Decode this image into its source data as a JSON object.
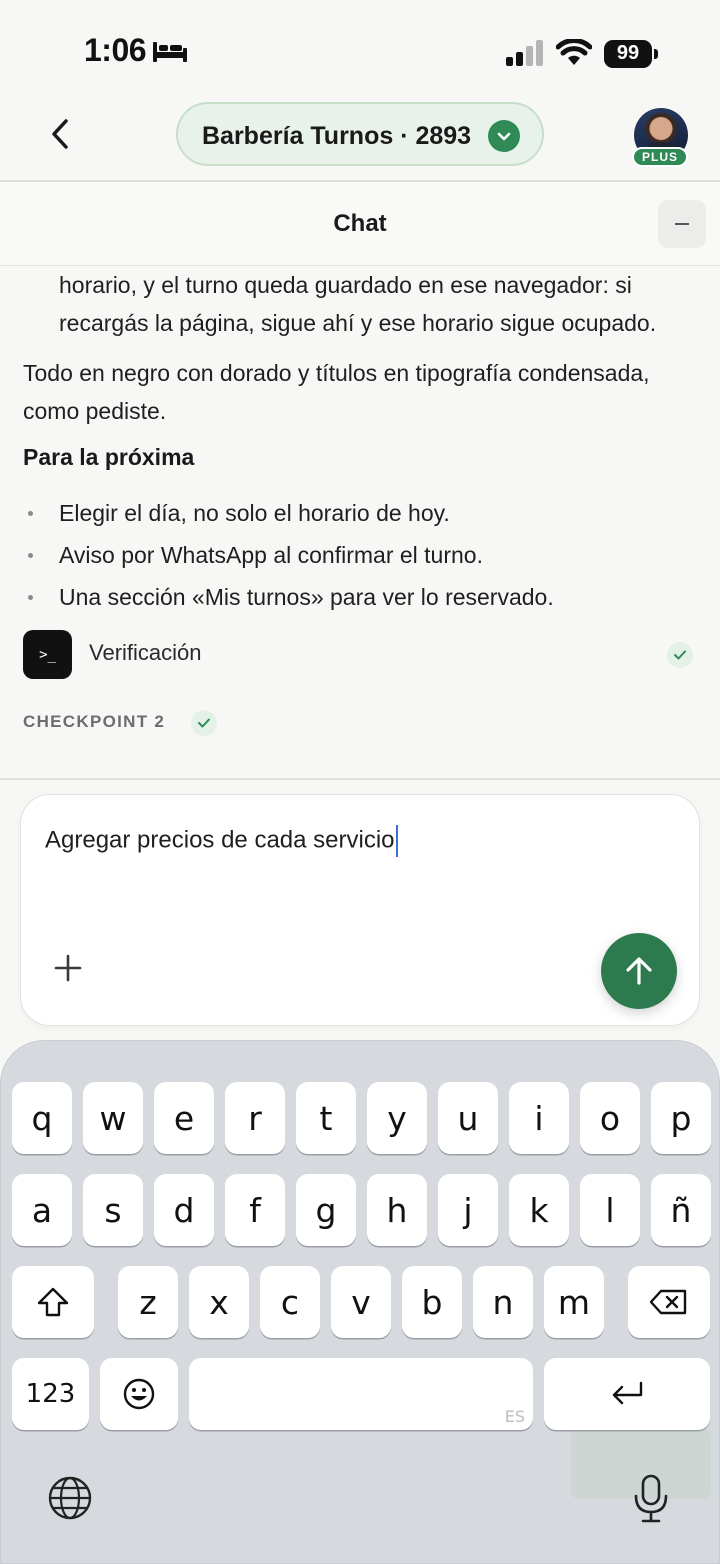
{
  "status_bar": {
    "time": "1:06",
    "battery": "99",
    "icons": [
      "bed-icon",
      "signal-icon",
      "wifi-icon",
      "battery-icon"
    ]
  },
  "header": {
    "back_icon": "chevron-left-icon",
    "project_name": "Barbería Turnos · 2893",
    "project_status_icon": "chevron-down-icon",
    "plan_badge": "PLUS",
    "accent_color": "#2f8a55"
  },
  "chat": {
    "title": "Chat",
    "minimize_icon": "minus-icon",
    "messages": {
      "partial_bullet": "horario, y el turno queda guardado en ese navegador: si recargás la página, sigue ahí y ese horario sigue ocupado.",
      "paragraph": "Todo en negro con dorado y títulos en tipografía condensada, como pediste.",
      "next_heading": "Para la próxima",
      "next_items": [
        "Elegir el día, no solo el horario de hoy.",
        "Aviso por WhatsApp al confirmar el turno.",
        "Una sección «Mis turnos» para ver lo reservado."
      ],
      "verification_label": "Verificación",
      "terminal_glyph": ">_",
      "checkpoint_label": "CHECKPOINT 2"
    }
  },
  "composer": {
    "input_value": "Agregar precios de cada servicio",
    "attach_icon": "plus-icon",
    "send_icon": "arrow-up-icon",
    "send_color": "#2e7a4f"
  },
  "keyboard": {
    "row1": [
      "q",
      "w",
      "e",
      "r",
      "t",
      "y",
      "u",
      "i",
      "o",
      "p"
    ],
    "row2": [
      "a",
      "s",
      "d",
      "f",
      "g",
      "h",
      "j",
      "k",
      "l",
      "ñ"
    ],
    "row3": [
      "z",
      "x",
      "c",
      "v",
      "b",
      "n",
      "m"
    ],
    "numbers_key": "123",
    "space_lang": "ES",
    "shift_icon": "shift-icon",
    "delete_icon": "backspace-icon",
    "emoji_icon": "emoji-icon",
    "return_icon": "return-icon",
    "globe_icon": "globe-icon",
    "mic_icon": "microphone-icon"
  }
}
